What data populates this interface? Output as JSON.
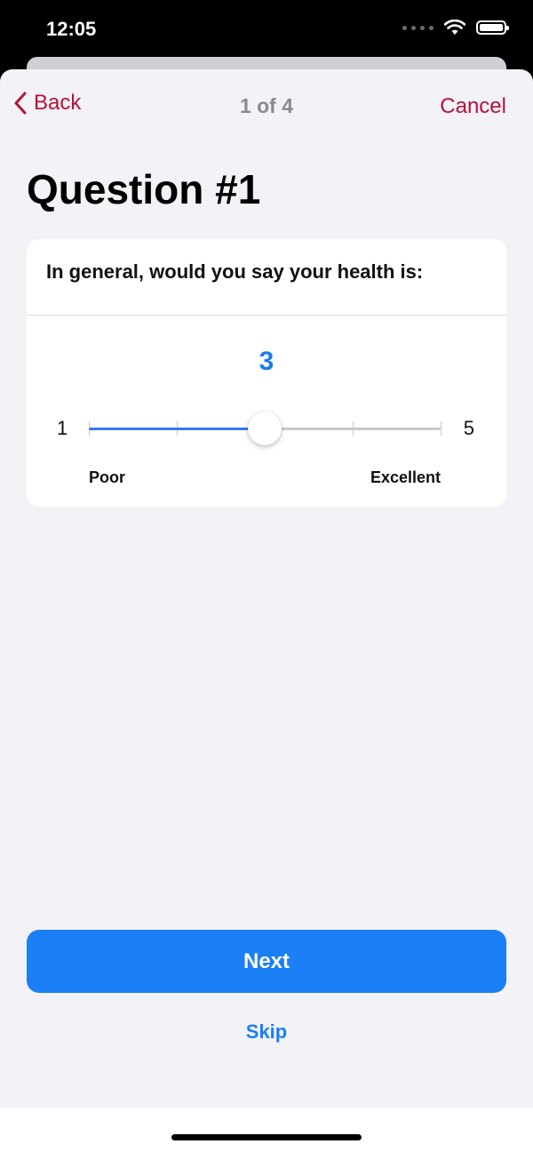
{
  "status": {
    "time": "12:05"
  },
  "nav": {
    "back_label": "Back",
    "progress": "1 of 4",
    "cancel_label": "Cancel"
  },
  "survey": {
    "title": "Question #1",
    "question": "In general, would you say your health is:",
    "selected_value": "3",
    "min_value": "1",
    "max_value": "5",
    "min_text": "Poor",
    "max_text": "Excellent"
  },
  "actions": {
    "next_label": "Next",
    "skip_label": "Skip"
  },
  "colors": {
    "accent": "#1b7ff5",
    "nav_tint": "#b5123a",
    "background": "#f2f2f7"
  },
  "icons": {
    "back": "chevron-left-icon",
    "wifi": "wifi-icon",
    "battery": "battery-icon",
    "signal": "cellular-dots-icon"
  }
}
